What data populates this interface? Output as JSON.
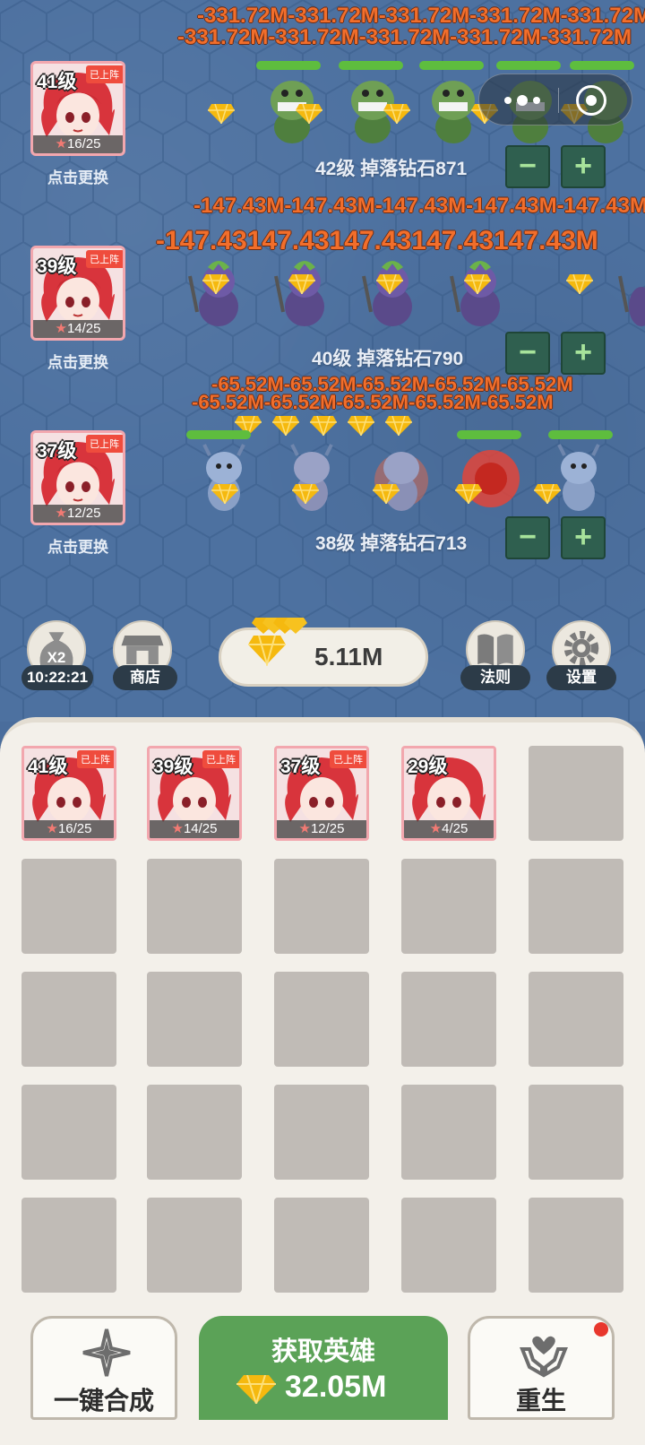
{
  "colors": {
    "battlefield": "#4d71a0",
    "damage_text": "#f26e2b",
    "hp_bar": "#5ebd3e",
    "step_button": "#2f5f4f",
    "primary_button": "#5ba257",
    "inventory_bg": "#f3f0ea",
    "badge": "#ef4c3d"
  },
  "lanes": [
    {
      "hero_level": "41级",
      "deployed_badge": "已上阵",
      "stars": "16/25",
      "change_label": "点击更换",
      "drop_text": "42级 掉落钻石871",
      "damage_lines": [
        "-331.72M-331.72M-331.72M-331.72M-331.72M",
        "-331.72M-331.72M-331.72M-331.72M-331.72M"
      ],
      "minus": "−",
      "plus": "+"
    },
    {
      "hero_level": "39级",
      "deployed_badge": "已上阵",
      "stars": "14/25",
      "change_label": "点击更换",
      "drop_text": "40级 掉落钻石790",
      "damage_lines": [
        "-147.43M-147.43M-147.43M-147.43M-147.43M",
        "-147.43147.43147.43147.43147.43M"
      ],
      "minus": "−",
      "plus": "+"
    },
    {
      "hero_level": "37级",
      "deployed_badge": "已上阵",
      "stars": "12/25",
      "change_label": "点击更换",
      "drop_text": "38级 掉落钻石713",
      "damage_lines": [
        "-65.52M-65.52M-65.52M-65.52M-65.52M",
        "-65.52M-65.52M-65.52M-65.52M-65.52M"
      ],
      "minus": "−",
      "plus": "+"
    }
  ],
  "toolbar": {
    "double_label": "X2",
    "timer": "10:22:21",
    "shop_label": "商店",
    "gem_total": "5.11M",
    "rules_label": "法则",
    "settings_label": "设置"
  },
  "inventory": [
    {
      "level": "41级",
      "badge": "已上阵",
      "stars": "16/25"
    },
    {
      "level": "39级",
      "badge": "已上阵",
      "stars": "14/25"
    },
    {
      "level": "37级",
      "badge": "已上阵",
      "stars": "12/25"
    },
    {
      "level": "29级",
      "badge": "",
      "stars": "4/25"
    }
  ],
  "bottom": {
    "merge_label": "一键合成",
    "get_hero_label": "获取英雄",
    "get_hero_cost": "32.05M",
    "rebirth_label": "重生"
  },
  "icons": {
    "capsule_more": "more-dots-icon",
    "capsule_close": "target-ring-icon",
    "double": "money-bag-icon",
    "shop": "shop-stall-icon",
    "rules": "book-icon",
    "settings": "gear-icon",
    "merge": "sparkle-icon",
    "rebirth": "hands-heart-icon",
    "currency": "diamond-icon"
  }
}
